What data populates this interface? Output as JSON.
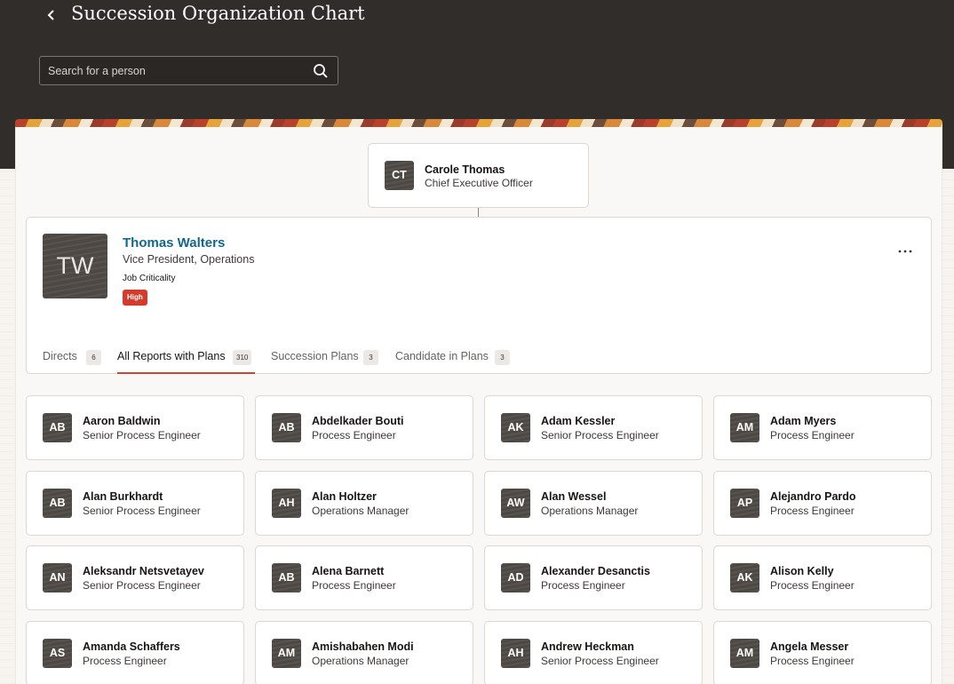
{
  "header": {
    "title": "Succession Organization Chart",
    "back_icon": "chevron-left-icon",
    "search": {
      "placeholder": "Search for a person",
      "value": "",
      "icon": "search-icon"
    }
  },
  "colors": {
    "header_bg": "#312d2a",
    "link": "#14678c",
    "criticality_high": "#d13c2c",
    "tab_active_underline": "#c74634"
  },
  "manager": {
    "initials": "CT",
    "name": "Carole Thomas",
    "title": "Chief Executive Officer"
  },
  "focus": {
    "initials": "TW",
    "name": "Thomas Walters",
    "title": "Vice President, Operations",
    "criticality_label": "Job Criticality",
    "criticality_value": "High",
    "more_icon": "ellipsis-icon"
  },
  "tabs": [
    {
      "label": "Directs",
      "count": "6",
      "active": false
    },
    {
      "label": "All Reports with Plans",
      "count": "310",
      "active": true
    },
    {
      "label": "Succession Plans",
      "count": "3",
      "active": false
    },
    {
      "label": "Candidate in Plans",
      "count": "3",
      "active": false
    }
  ],
  "people": [
    {
      "initials": "AB",
      "name": "Aaron Baldwin",
      "title": "Senior Process Engineer"
    },
    {
      "initials": "AB",
      "name": "Abdelkader Bouti",
      "title": "Process Engineer"
    },
    {
      "initials": "AK",
      "name": "Adam Kessler",
      "title": "Senior Process Engineer"
    },
    {
      "initials": "AM",
      "name": "Adam Myers",
      "title": "Process Engineer"
    },
    {
      "initials": "AB",
      "name": "Alan Burkhardt",
      "title": "Senior Process Engineer"
    },
    {
      "initials": "AH",
      "name": "Alan Holtzer",
      "title": "Operations Manager"
    },
    {
      "initials": "AW",
      "name": "Alan Wessel",
      "title": "Operations Manager"
    },
    {
      "initials": "AP",
      "name": "Alejandro Pardo",
      "title": "Process Engineer"
    },
    {
      "initials": "AN",
      "name": "Aleksandr Netsvetayev",
      "title": "Senior Process Engineer"
    },
    {
      "initials": "AB",
      "name": "Alena Barnett",
      "title": "Process Engineer"
    },
    {
      "initials": "AD",
      "name": "Alexander Desanctis",
      "title": "Process Engineer"
    },
    {
      "initials": "AK",
      "name": "Alison Kelly",
      "title": "Process Engineer"
    },
    {
      "initials": "AS",
      "name": "Amanda Schaffers",
      "title": "Process Engineer"
    },
    {
      "initials": "AM",
      "name": "Amishabahen Modi",
      "title": "Operations Manager"
    },
    {
      "initials": "AH",
      "name": "Andrew Heckman",
      "title": "Senior Process Engineer"
    },
    {
      "initials": "AM",
      "name": "Angela Messer",
      "title": "Process Engineer"
    }
  ]
}
